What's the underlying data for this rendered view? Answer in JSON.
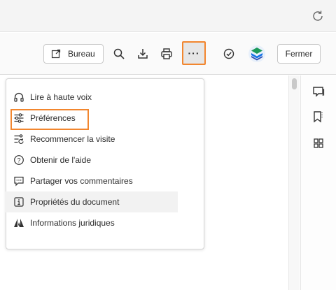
{
  "topbar": {
    "reload_icon": "reload-icon"
  },
  "toolbar": {
    "desktop_label": "Bureau",
    "more_label": "···",
    "close_label": "Fermer",
    "icons": [
      "open-desktop-icon",
      "search-icon",
      "download-icon",
      "print-icon",
      "more-icon",
      "checkmark-circle-icon",
      "adobe-account-icon"
    ]
  },
  "menu": {
    "items": [
      {
        "label": "Lire à haute voix",
        "icon": "headphones-icon"
      },
      {
        "label": "Préférences",
        "icon": "sliders-icon",
        "highlighted": true
      },
      {
        "label": "Recommencer la visite",
        "icon": "restart-tour-icon"
      },
      {
        "label": "Obtenir de l'aide",
        "icon": "help-icon"
      },
      {
        "label": "Partager vos commentaires",
        "icon": "feedback-icon"
      },
      {
        "label": "Propriétés du document",
        "icon": "info-icon",
        "hovered": true
      },
      {
        "label": "Informations juridiques",
        "icon": "adobe-logo-icon"
      }
    ]
  },
  "rightrail": {
    "icons": [
      "comment-icon",
      "bookmark-icon",
      "grid-icon"
    ]
  },
  "colors": {
    "highlight": "#f2862e",
    "hover_bg": "#f2f2f2"
  }
}
